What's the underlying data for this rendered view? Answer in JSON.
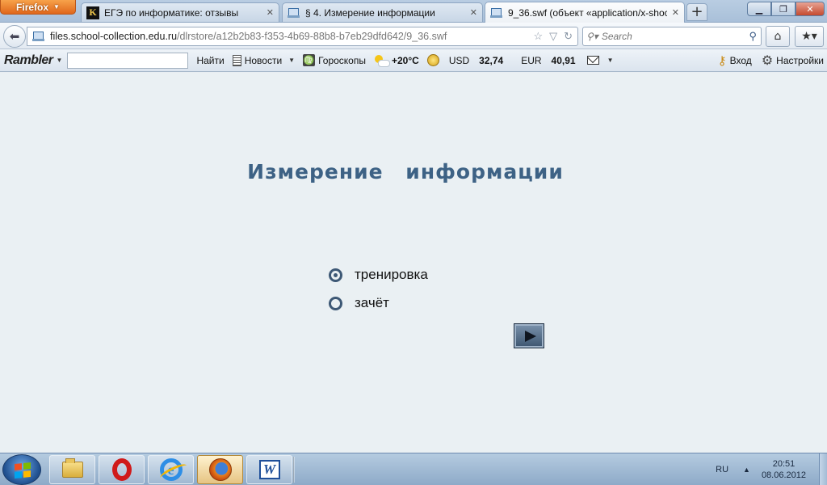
{
  "browser": {
    "app_menu_label": "Firefox",
    "tabs": [
      {
        "label": "ЕГЭ по информатике: отзывы",
        "icon": "k-site-icon"
      },
      {
        "label": "§ 4. Измерение информации",
        "icon": "page-icon"
      },
      {
        "label": "9_36.swf (объект «application/x-shoc…",
        "icon": "page-icon",
        "active": true
      }
    ],
    "new_tab_label": "+",
    "url_host": "files.school-collection.edu.ru",
    "url_path": "/dlrstore/a12b2b83-f353-4b69-88b8-b7eb29dfd642/9_36.swf",
    "search_placeholder": "Search"
  },
  "rambler": {
    "logo": "Rambler",
    "find_label": "Найти",
    "news_label": "Новости",
    "horoscopes_label": "Гороскопы",
    "temperature": "+20°C",
    "usd_label": "USD",
    "usd_value": "32,74",
    "eur_label": "EUR",
    "eur_value": "40,91",
    "login_label": "Вход",
    "settings_label": "Настройки"
  },
  "content": {
    "title": "Измерение информации",
    "options": [
      {
        "label": "тренировка",
        "selected": true
      },
      {
        "label": "зачёт",
        "selected": false
      }
    ]
  },
  "taskbar": {
    "language": "RU",
    "time": "20:51",
    "date": "08.06.2012"
  },
  "colors": {
    "title_blue": "#3d6285",
    "firefox_orange": "#e0671b",
    "content_bg": "#eaf0f3"
  }
}
